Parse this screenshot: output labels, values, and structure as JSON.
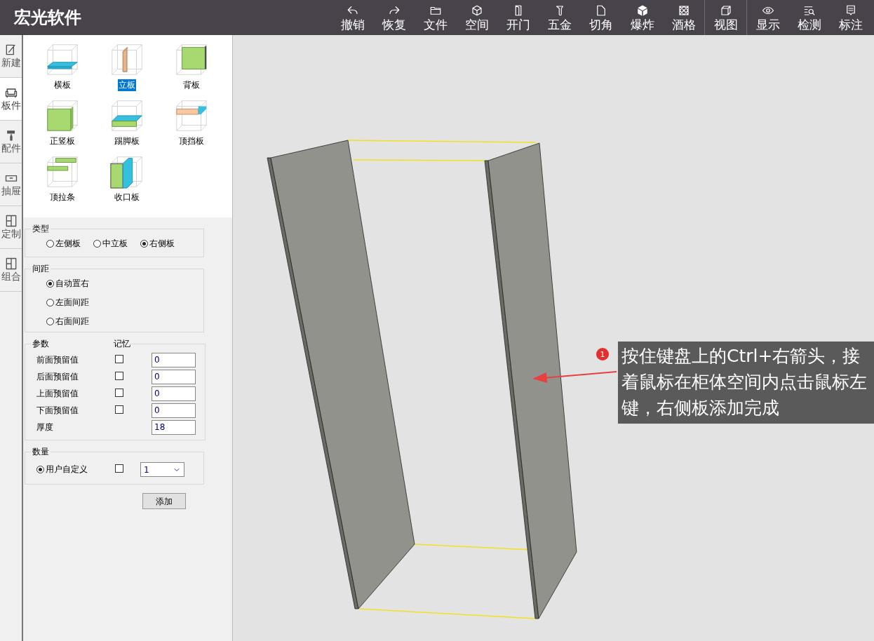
{
  "app": {
    "title": "宏光软件"
  },
  "toolbar": {
    "groups": [
      [
        {
          "label": "撤销"
        },
        {
          "label": "恢复"
        },
        {
          "label": "文件"
        },
        {
          "label": "空间"
        },
        {
          "label": "开门"
        },
        {
          "label": "五金"
        },
        {
          "label": "切角"
        },
        {
          "label": "爆炸"
        },
        {
          "label": "酒格"
        }
      ],
      [
        {
          "label": "视图"
        }
      ],
      [
        {
          "label": "显示"
        },
        {
          "label": "检测"
        },
        {
          "label": "标注"
        }
      ]
    ]
  },
  "side_rail": {
    "items": [
      {
        "label": "新建",
        "selected": false
      },
      {
        "label": "板件",
        "selected": true
      },
      {
        "label": "配件",
        "selected": false
      },
      {
        "label": "抽屉",
        "selected": false
      },
      {
        "label": "定制",
        "selected": false
      },
      {
        "label": "组合",
        "selected": false
      }
    ]
  },
  "parts": {
    "items": [
      {
        "label": "横板",
        "selected": false
      },
      {
        "label": "立板",
        "selected": true
      },
      {
        "label": "背板",
        "selected": false
      },
      {
        "label": "正竖板",
        "selected": false
      },
      {
        "label": "踢脚板",
        "selected": false
      },
      {
        "label": "顶挡板",
        "selected": false
      },
      {
        "label": "顶拉条",
        "selected": false
      },
      {
        "label": "收口板",
        "selected": false
      }
    ]
  },
  "type_group": {
    "title": "类型",
    "options": [
      {
        "label": "左侧板",
        "selected": false
      },
      {
        "label": "中立板",
        "selected": false
      },
      {
        "label": "右侧板",
        "selected": true
      }
    ]
  },
  "spacing_group": {
    "title": "间距",
    "options": [
      {
        "label": "自动置右",
        "selected": true
      },
      {
        "label": "左面间距",
        "selected": false
      },
      {
        "label": "右面间距",
        "selected": false
      }
    ]
  },
  "params_group": {
    "title": "参数",
    "memory_heading": "记忆",
    "rows": [
      {
        "kind": "reserve",
        "label": "前面预留值",
        "checked": false,
        "value": "0"
      },
      {
        "kind": "reserve",
        "label": "后面预留值",
        "checked": false,
        "value": "0"
      },
      {
        "kind": "reserve",
        "label": "上面预留值",
        "checked": false,
        "value": "0"
      },
      {
        "kind": "reserve",
        "label": "下面预留值",
        "checked": false,
        "value": "0"
      },
      {
        "kind": "plain",
        "label": "厚度",
        "value": "18"
      }
    ]
  },
  "quantity_group": {
    "title": "数量",
    "option": {
      "label": "用户自定义",
      "selected": true
    },
    "checked": false,
    "value": "1"
  },
  "add_button": "添加",
  "hint": {
    "badge": "1",
    "text": "按住键盘上的Ctrl+右箭头，接着鼠标在柜体空间内点击鼠标左键，右侧板添加完成"
  }
}
